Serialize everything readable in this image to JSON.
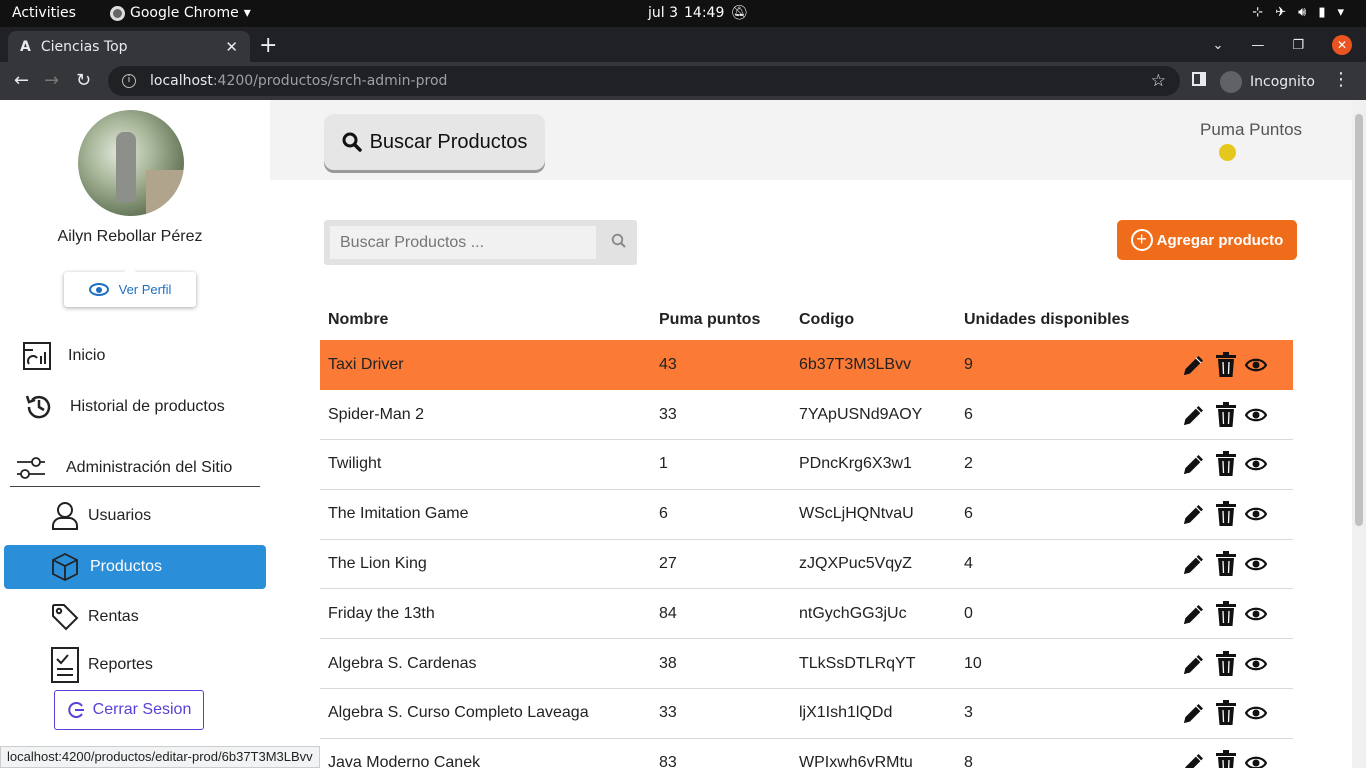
{
  "os": {
    "activities": "Activities",
    "app_menu": "Google Chrome",
    "date": "jul 3",
    "time": "14:49"
  },
  "browser": {
    "tab_title": "Ciencias Top",
    "favicon": "A",
    "url_host": "localhost",
    "url_path": ":4200/productos/srch-admin-prod",
    "profile": "Incognito",
    "status_url": "localhost:4200/productos/editar-prod/6b37T3M3LBvv"
  },
  "sidebar": {
    "user_name": "Ailyn Rebollar Pérez",
    "profile_button": "Ver Perfil",
    "items": [
      {
        "label": "Inicio",
        "icon": "dashboard-icon"
      },
      {
        "label": "Historial de productos",
        "icon": "history-icon"
      },
      {
        "label": "Administración del Sitio",
        "icon": "sliders-icon"
      },
      {
        "label": "Usuarios",
        "icon": "user-icon"
      },
      {
        "label": "Productos",
        "icon": "box-icon"
      },
      {
        "label": "Rentas",
        "icon": "tag-icon"
      },
      {
        "label": "Reportes",
        "icon": "report-icon"
      }
    ],
    "logout": "Cerrar Sesion",
    "active_color": "#2b8ed9"
  },
  "header": {
    "title": "Buscar Productos",
    "points_label": "Puma Puntos"
  },
  "search": {
    "placeholder": "Buscar Productos ..."
  },
  "add_button": "Agregar producto",
  "accent_color": "#ef6c1a",
  "table": {
    "columns": [
      "Nombre",
      "Puma puntos",
      "Codigo",
      "Unidades disponibles"
    ],
    "rows": [
      [
        "Taxi Driver",
        "43",
        "6b37T3M3LBvv",
        "9"
      ],
      [
        "Spider-Man 2",
        "33",
        "7YApUSNd9AOY",
        "6"
      ],
      [
        "Twilight",
        "1",
        "PDncKrg6X3w1",
        "2"
      ],
      [
        "The Imitation Game",
        "6",
        "WScLjHQNtvaU",
        "6"
      ],
      [
        "The Lion King",
        "27",
        "zJQXPuc5VqyZ",
        "4"
      ],
      [
        "Friday the 13th",
        "84",
        "ntGychGG3jUc",
        "0"
      ],
      [
        "Algebra S. Cardenas",
        "38",
        "TLkSsDTLRqYT",
        "10"
      ],
      [
        "Algebra S. Curso Completo Laveaga",
        "33",
        "ljX1Ish1lQDd",
        "3"
      ],
      [
        "Java Moderno Canek",
        "83",
        "WPIxwh6vRMtu",
        "8"
      ]
    ]
  }
}
